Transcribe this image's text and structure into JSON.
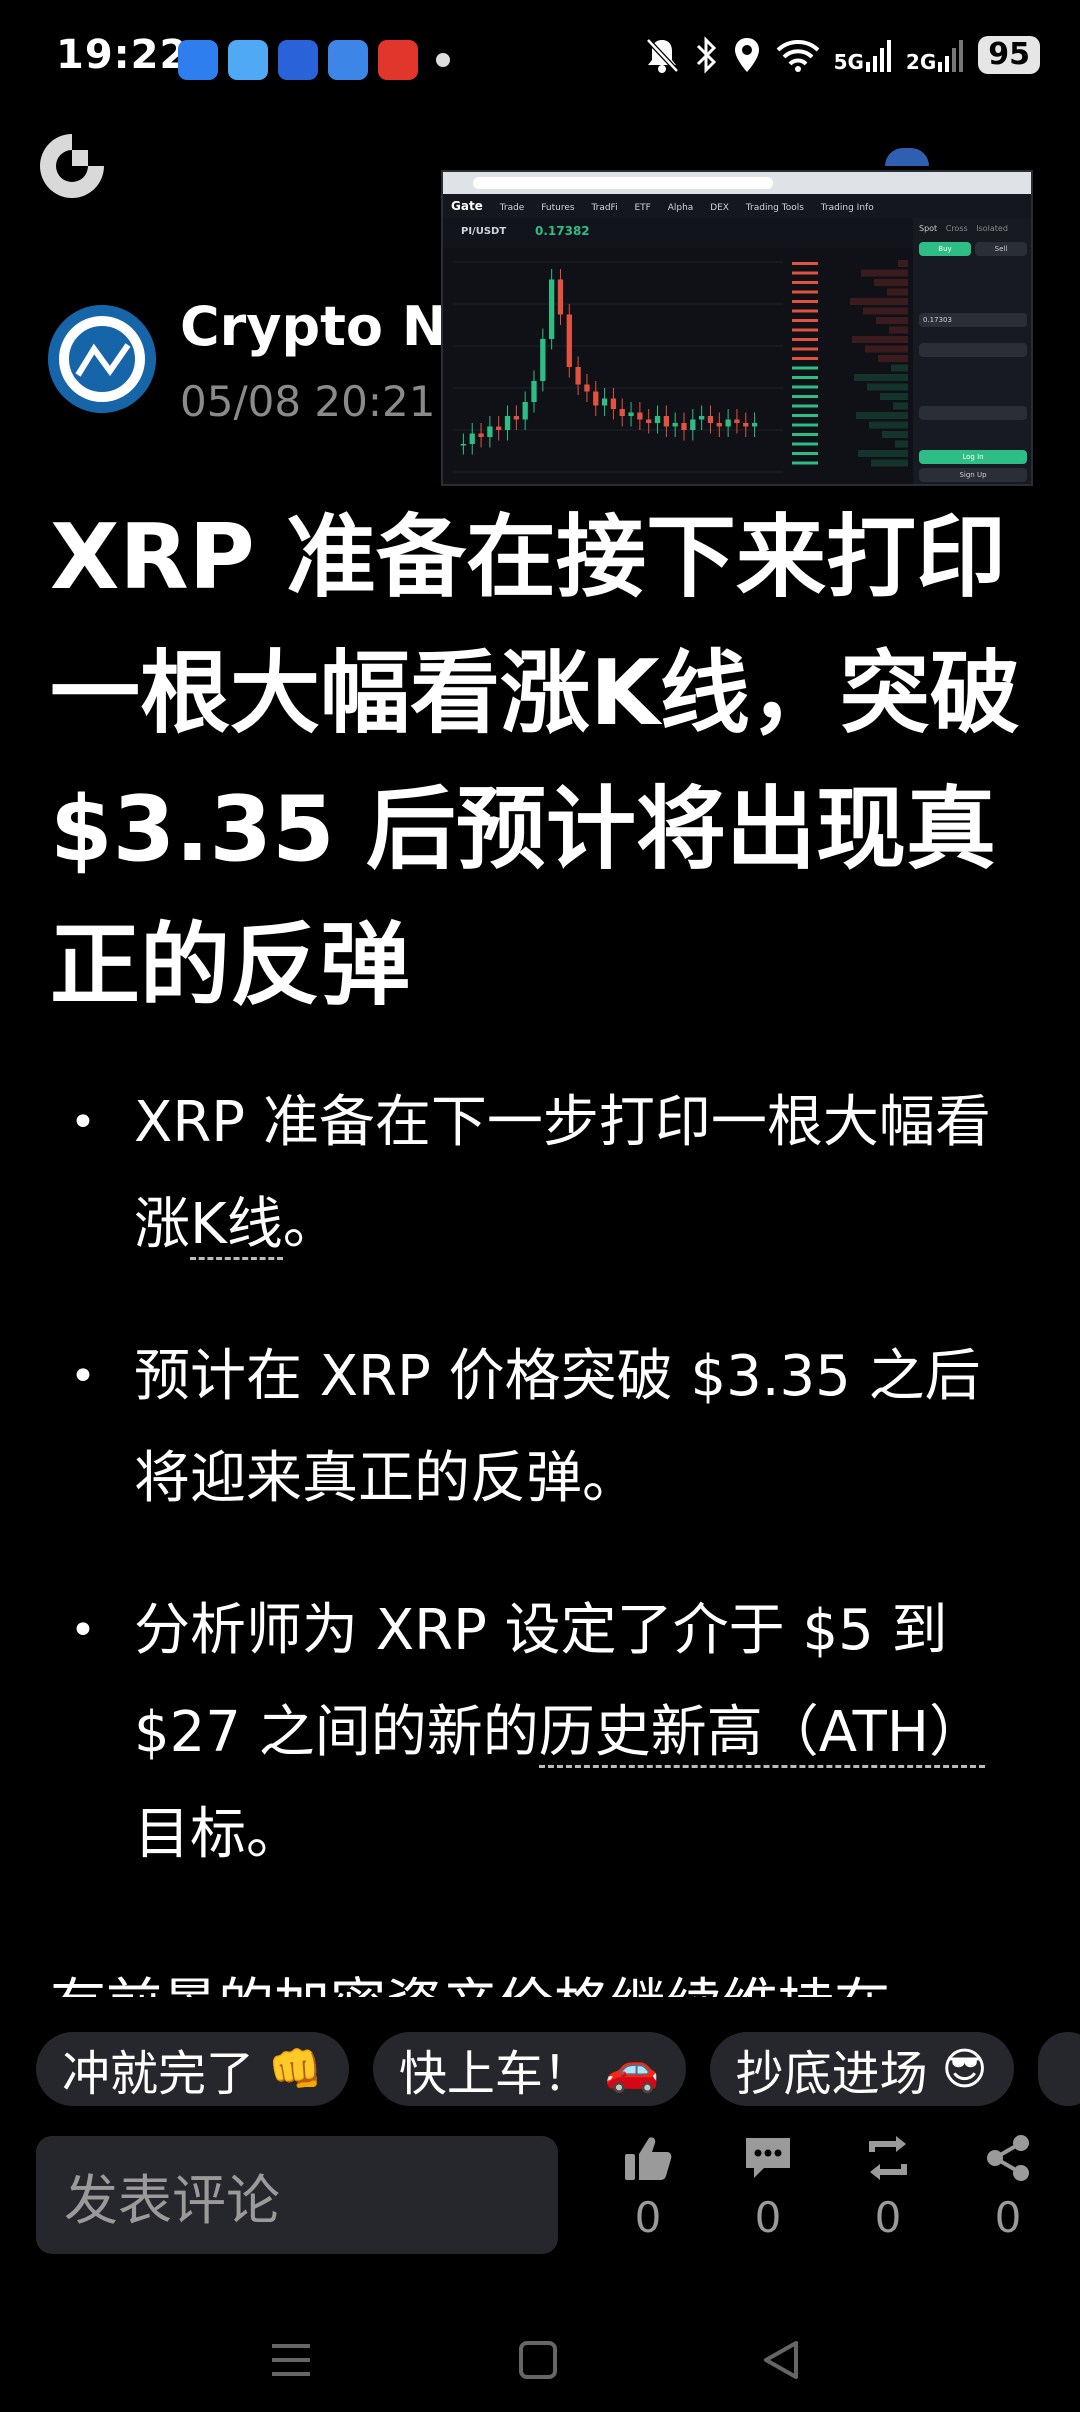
{
  "status_bar": {
    "time": "19:22",
    "network_5g": "5G",
    "network_2g": "2G",
    "battery": "95",
    "notification_icons": [
      "app-icon-1",
      "weather-icon",
      "car-app-icon",
      "chart-app-icon",
      "shopping-app-icon"
    ]
  },
  "post": {
    "author_name": "Crypto News",
    "time": "05/08 20:21",
    "title": "XRP 准备在接下来打印一根大幅看涨K线，突破 $3.35 后预计将出现真正的反弹",
    "bullets": [
      {
        "before": "XRP 准备在下一步打印一根大幅看涨",
        "link": "K线",
        "after": "。"
      },
      {
        "before": "预计在 XRP 价格突破 $3.35 之后将迎来真正的反弹。",
        "link": "",
        "after": ""
      },
      {
        "before": "分析师为 XRP 设定了介于 $5 到 $27 之间的新的",
        "link": "历史新高（ATH）",
        "after": "目标。"
      }
    ],
    "next_paragraph_partial": "有前景的加密资产价格继续维持在"
  },
  "chart_preview": {
    "brand": "Gate",
    "symbol": "PI/USDT",
    "price": "0.17382",
    "nav_items": [
      "Trade",
      "Futures",
      "TradFi",
      "ETF",
      "Alpha",
      "DEX",
      "Trading Tools",
      "Trading Info"
    ],
    "trade_tabs": [
      "Spot",
      "Cross",
      "Isolated"
    ],
    "buy_label": "Buy",
    "sell_label": "Sell",
    "order_price": "0.17303",
    "login_label": "Log In",
    "signup_label": "Sign Up",
    "candle_closes": [
      0.168,
      0.171,
      0.17,
      0.173,
      0.172,
      0.176,
      0.175,
      0.18,
      0.186,
      0.198,
      0.215,
      0.205,
      0.19,
      0.185,
      0.183,
      0.179,
      0.181,
      0.178,
      0.176,
      0.177,
      0.175,
      0.174,
      0.176,
      0.173,
      0.174,
      0.172,
      0.175,
      0.176,
      0.174,
      0.173,
      0.175,
      0.174,
      0.173,
      0.174
    ]
  },
  "quick_replies": [
    {
      "text": "冲就完了",
      "emoji": "👊"
    },
    {
      "text": "快上车！",
      "emoji": "🚗"
    },
    {
      "text": "抄底进场",
      "emoji": "😎"
    }
  ],
  "bottom_bar": {
    "comment_placeholder": "发表评论",
    "like_count": "0",
    "comment_count": "0",
    "repost_count": "0",
    "share_count": "0"
  }
}
